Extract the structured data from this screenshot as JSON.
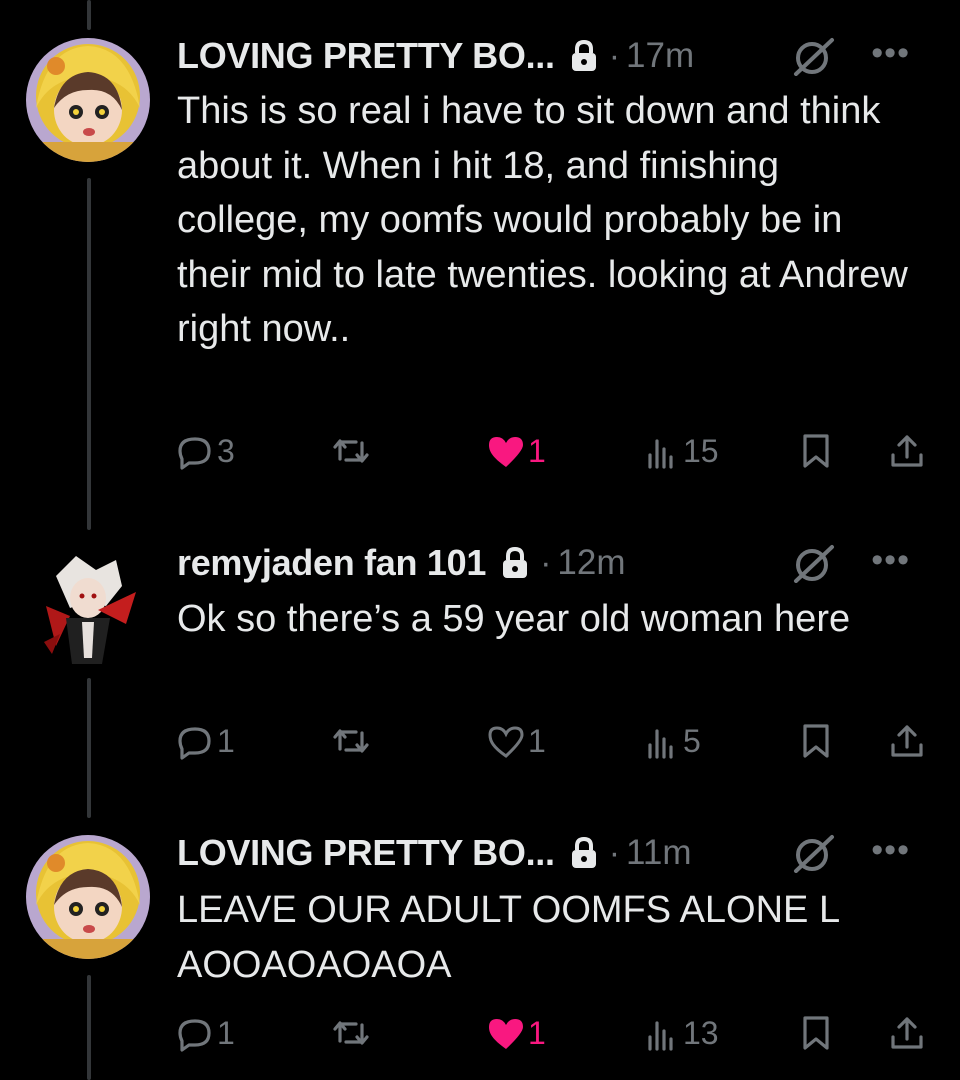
{
  "tweets": [
    {
      "name": "LOVING PRETTY BO...",
      "time": "17m",
      "text": "This is so real i have to sit down and think about it. When i hit 18, and finishing college, my oomfs would probably be in their mid to late twenties.  looking at Andrew right now..",
      "replies": "3",
      "retweets": "",
      "likes": "1",
      "liked": true,
      "views": "15",
      "avatar": "yellow-hooded-anime-avatar"
    },
    {
      "name": "remyjaden fan 101",
      "time": "12m",
      "text": "Ok so there’s a 59 year old woman here",
      "replies": "1",
      "retweets": "",
      "likes": "1",
      "liked": false,
      "views": "5",
      "avatar": "red-black-anime-avatar"
    },
    {
      "name": "LOVING PRETTY BO...",
      "time": "11m",
      "text": "LEAVE OUR ADULT OOMFS ALONE L AOOAOAOAOA",
      "replies": "1",
      "retweets": "",
      "likes": "1",
      "liked": true,
      "views": "13",
      "avatar": "yellow-hooded-anime-avatar"
    }
  ],
  "colors": {
    "background": "#000000",
    "text": "#e7e9ea",
    "muted": "#71767b",
    "like": "#f91880",
    "thread_line": "#333639"
  },
  "icons": [
    "lock-icon",
    "grok-icon",
    "more-icon",
    "reply-icon",
    "retweet-icon",
    "like-icon",
    "views-icon",
    "bookmark-icon",
    "share-icon"
  ]
}
